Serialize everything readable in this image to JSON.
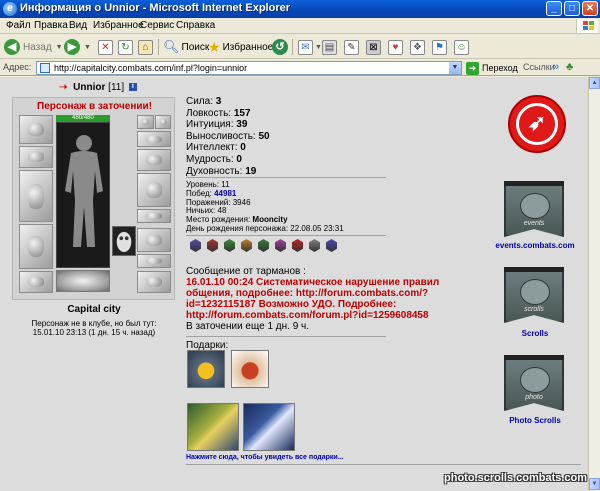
{
  "window": {
    "title": "Информация о Unnior - Microsoft Internet Explorer"
  },
  "menu": [
    "Файл",
    "Правка",
    "Вид",
    "Избранное",
    "Сервис",
    "Справка"
  ],
  "toolbar": {
    "back_label": "Назад",
    "search_label": "Поиск",
    "favorites_label": "Избранное"
  },
  "address": {
    "label": "Адрес:",
    "url": "http://capitalcity.combats.com/inf.pl?login=unnior",
    "go_label": "Переход",
    "links_label": "Ссылки"
  },
  "character": {
    "name": "Unnior",
    "level": "[11]",
    "prison_status": "Персонаж в заточении!",
    "hp": "480/480",
    "city": "Capital city",
    "presence_line1": "Персонаж не в клубе, но был тут:",
    "presence_line2": "15.01.10 23:13 (1 дн. 15 ч. назад)"
  },
  "stats": [
    {
      "label": "Сила:",
      "value": "3"
    },
    {
      "label": "Ловкость:",
      "value": "157"
    },
    {
      "label": "Интуиция:",
      "value": "39"
    },
    {
      "label": "Выносливость:",
      "value": "50"
    },
    {
      "label": "Интеллект:",
      "value": "0"
    },
    {
      "label": "Мудрость:",
      "value": "0"
    },
    {
      "label": "Духовность:",
      "value": "19"
    }
  ],
  "details": {
    "level_label": "Уровень:",
    "level_value": "11",
    "wins_label": "Побед:",
    "wins_value": "44981",
    "losses_label": "Поражений:",
    "losses_value": "3946",
    "draws_label": "Ничьих:",
    "draws_value": "48",
    "birthplace_label": "Место рождения:",
    "birthplace_value": "Mooncity",
    "birthday_label": "День рождения персонажа:",
    "birthday_value": "22.08.05 23:31"
  },
  "medals": [
    {
      "name": "medal-1-icon",
      "color": "#5a4aa8"
    },
    {
      "name": "medal-2-icon",
      "color": "#b03030"
    },
    {
      "name": "medal-3-icon",
      "color": "#3a8a3a"
    },
    {
      "name": "medal-4-icon",
      "color": "#c08030"
    },
    {
      "name": "medal-5-icon",
      "color": "#3a7a3a"
    },
    {
      "name": "medal-6-icon",
      "color": "#a040a0"
    },
    {
      "name": "medal-7-icon",
      "color": "#c02020"
    },
    {
      "name": "medal-8-icon",
      "color": "#808080"
    },
    {
      "name": "medal-9-icon",
      "color": "#4a4ab0"
    }
  ],
  "message": {
    "header": "Сообщение от тарманов :",
    "text": "16.01.10 00:24 Систематическое нарушение правил общения, подробнее: http://forum.combats.com/?id=1232115187 Возможно УДО. Подробнее: http://forum.combats.com/forum.pl?id=1259608458",
    "remaining": "В заточении еще 1 дн. 9 ч."
  },
  "gifts": {
    "label": "Подарки:",
    "see_all": "Нажмите сюда, чтобы увидеть все подарки..."
  },
  "links": [
    {
      "label": "events.combats.com",
      "banner_word": "events"
    },
    {
      "label": "Scrolls",
      "banner_word": "scrolls"
    },
    {
      "label": "Photo Scrolls",
      "banner_word": "photo"
    }
  ],
  "watermark": "photo.scrolls.combats.com",
  "colors": {
    "accent_red": "#c00000",
    "link_blue": "#0000b0",
    "titlebar": "#0a5fd8"
  }
}
